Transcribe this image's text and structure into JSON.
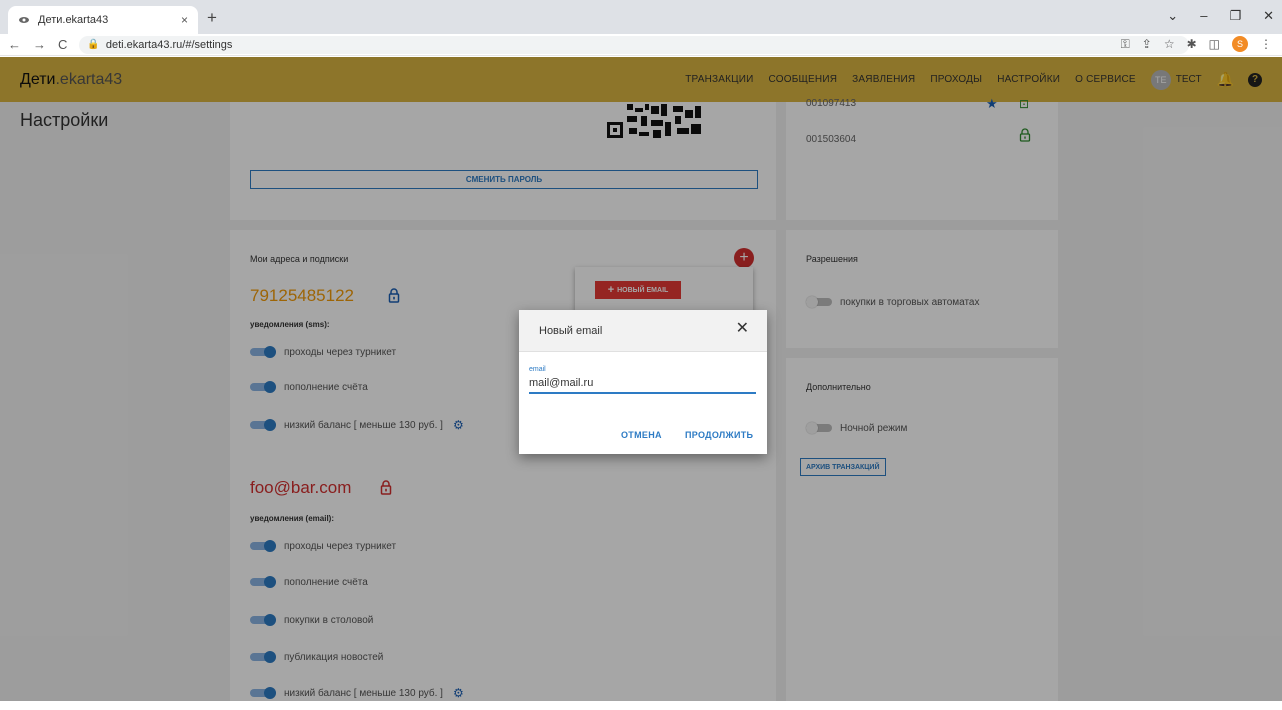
{
  "browser": {
    "tab_title": "Дети.ekarta43",
    "tab_close": "×",
    "new_tab": "+",
    "url": "deti.ekarta43.ru/#/settings",
    "profile_initial": "S"
  },
  "app": {
    "brand_bold": "Дети",
    "brand_light": ".ekarta43",
    "nav": {
      "transactions": "ТРАНЗАКЦИИ",
      "messages": "СООБЩЕНИЯ",
      "applications": "ЗАЯВЛЕНИЯ",
      "passes": "ПРОХОДЫ",
      "settings": "НАСТРОЙКИ",
      "about": "О СЕРВИСЕ"
    },
    "user_initials": "TE",
    "user_name": "ТЕСТ"
  },
  "page": {
    "title": "Настройки",
    "change_password": "СМЕНИТЬ ПАРОЛЬ",
    "cards": [
      "001097413",
      "001503604"
    ],
    "contacts_title": "Мои адреса и подписки",
    "new_email_button": "НОВЫЙ EMAIL",
    "phone": "79125485122",
    "sms_label": "уведомления (sms):",
    "sms_toggles": [
      {
        "label": "проходы через турникет",
        "on": true
      },
      {
        "label": "пополнение счёта",
        "on": true
      },
      {
        "label": "низкий баланс [ меньше 130 руб. ]",
        "on": true
      }
    ],
    "email": "foo@bar.com",
    "email_label": "уведомления (email):",
    "email_toggles": [
      {
        "label": "проходы через турникет",
        "on": true
      },
      {
        "label": "пополнение счёта",
        "on": true
      },
      {
        "label": "покупки в столовой",
        "on": true
      },
      {
        "label": "публикация новостей",
        "on": true
      },
      {
        "label": "низкий баланс [ меньше 130 руб. ]",
        "on": true
      }
    ],
    "permissions_title": "Разрешения",
    "permissions_toggle": "покупки в торговых автоматах",
    "extra_title": "Дополнительно",
    "night_mode": "Ночной режим",
    "archive_button": "АРХИВ ТРАНЗАКЦИЙ"
  },
  "dialog": {
    "title": "Новый email",
    "field_label": "email",
    "field_value": "mail@mail.ru",
    "cancel": "ОТМЕНА",
    "continue": "ПРОДОЛЖИТЬ"
  },
  "colors": {
    "header": "#d9b441",
    "accent": "#2d7bc4",
    "danger": "#e53935",
    "phone": "#f29b0a"
  }
}
